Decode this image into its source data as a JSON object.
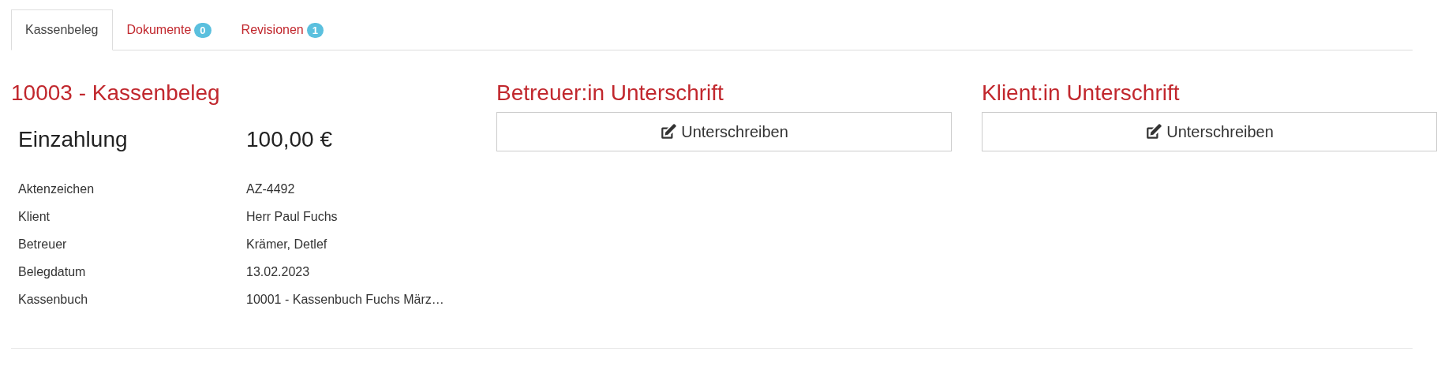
{
  "tabs": [
    {
      "label": "Kassenbeleg",
      "selected": true
    },
    {
      "label": "Dokumente",
      "badge": "0",
      "selected": false
    },
    {
      "label": "Revisionen",
      "badge": "1",
      "selected": false
    }
  ],
  "receipt": {
    "title": "10003 - Kassenbeleg",
    "type": "Einzahlung",
    "amount": "100,00 €",
    "fields": [
      {
        "label": "Aktenzeichen",
        "value": "AZ-4492"
      },
      {
        "label": "Klient",
        "value": "Herr Paul Fuchs"
      },
      {
        "label": "Betreuer",
        "value": "Krämer, Detlef"
      },
      {
        "label": "Belegdatum",
        "value": "13.02.2023"
      },
      {
        "label": "Kassenbuch",
        "value": "10001 - Kassenbuch Fuchs März…"
      }
    ]
  },
  "signatures": [
    {
      "title": "Betreuer:in Unterschrift",
      "button": "Unterschreiben"
    },
    {
      "title": "Klient:in Unterschrift",
      "button": "Unterschreiben"
    }
  ]
}
